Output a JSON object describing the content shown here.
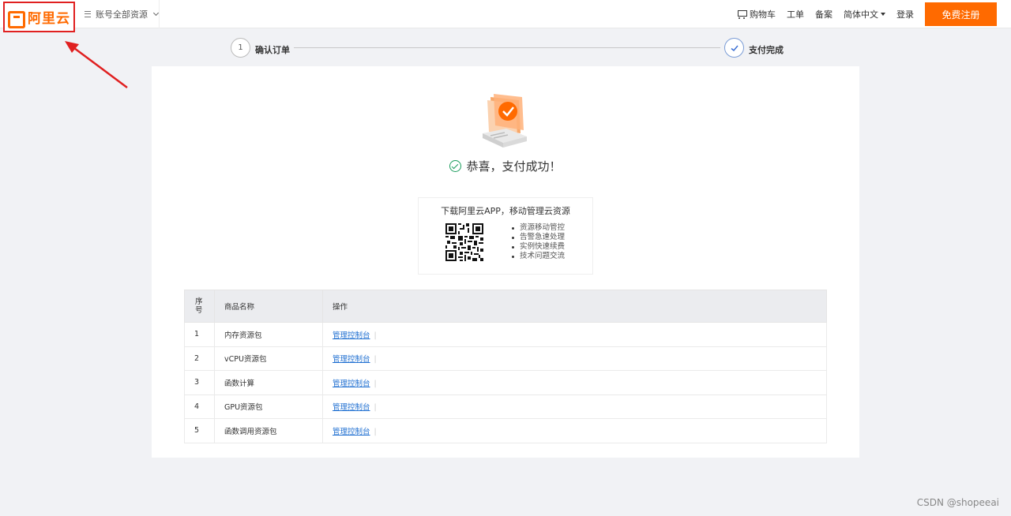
{
  "header": {
    "logo_text": "阿里云",
    "account_selector": "账号全部资源",
    "nav": {
      "cart": "购物车",
      "ticket": "工单",
      "filing": "备案",
      "language": "简体中文",
      "login": "登录",
      "signup": "免费注册"
    }
  },
  "steps": [
    {
      "index": "1",
      "label": "确认订单"
    },
    {
      "index": "✓",
      "label": "支付完成"
    }
  ],
  "result": {
    "message": "恭喜，支付成功！"
  },
  "app_promo": {
    "title": "下载阿里云APP，移动管理云资源",
    "features": [
      "资源移动管控",
      "告警急速处理",
      "实例快速续费",
      "技术问题交流"
    ]
  },
  "table": {
    "headers": [
      "序\n号",
      "商品名称",
      "操作"
    ],
    "rows": [
      {
        "no": "1",
        "name": "内存资源包",
        "action": "管理控制台"
      },
      {
        "no": "2",
        "name": "vCPU资源包",
        "action": "管理控制台"
      },
      {
        "no": "3",
        "name": "函数计算",
        "action": "管理控制台"
      },
      {
        "no": "4",
        "name": "GPU资源包",
        "action": "管理控制台"
      },
      {
        "no": "5",
        "name": "函数调用资源包",
        "action": "管理控制台"
      }
    ]
  },
  "watermark": "CSDN @shopeeai",
  "colors": {
    "brand": "#ff6a00",
    "success": "#1a9c5c",
    "link": "#1f6fd1",
    "annotation": "#e02020"
  }
}
